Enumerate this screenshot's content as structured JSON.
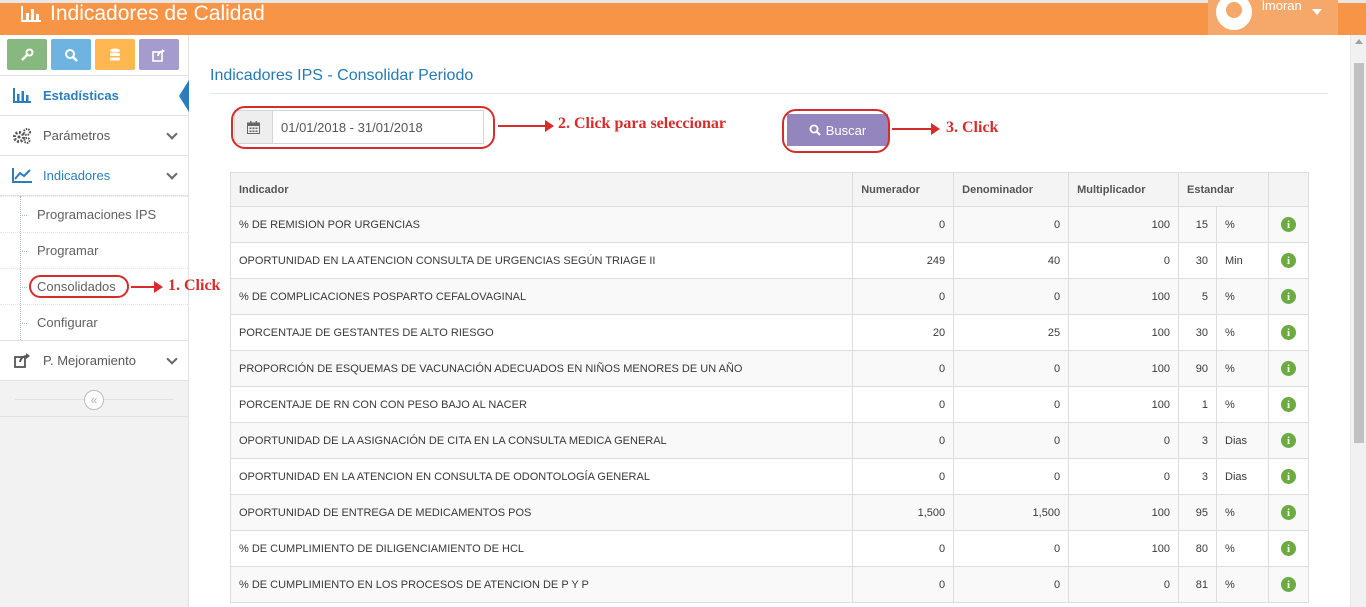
{
  "app": {
    "title": "Indicadores de Calidad",
    "brand_icon": "bar-chart-icon"
  },
  "user": {
    "name": "lmoran"
  },
  "sidebar": {
    "shortcuts": [
      {
        "icon": "wrench-icon",
        "color": "#87b87f"
      },
      {
        "icon": "search-icon",
        "color": "#6fb3e0"
      },
      {
        "icon": "database-icon",
        "color": "#ffb752"
      },
      {
        "icon": "share-icon",
        "color": "#a69bce"
      }
    ],
    "items": [
      {
        "label": "Estadísticas",
        "icon": "bar-chart-icon"
      },
      {
        "label": "Parámetros",
        "icon": "cogs-icon"
      },
      {
        "label": "Indicadores",
        "icon": "line-chart-icon"
      },
      {
        "label": "P. Mejoramiento",
        "icon": "share-icon"
      }
    ],
    "submenu": [
      "Programaciones IPS",
      "Programar",
      "Consolidados",
      "Configurar"
    ]
  },
  "main": {
    "title": "Indicadores IPS - Consolidar Periodo",
    "date_range": "01/01/2018 - 31/01/2018",
    "search_label": "Buscar"
  },
  "annotations": {
    "step1": "1. Click",
    "step2": "2. Click para seleccionar",
    "step3": "3. Click",
    "color": "#d62c2c"
  },
  "table": {
    "headers": [
      "Indicador",
      "Numerador",
      "Denominador",
      "Multiplicador",
      "Estandar"
    ],
    "rows": [
      {
        "indicador": "% DE REMISION POR URGENCIAS",
        "numerador": "0",
        "denominador": "0",
        "multiplicador": "100",
        "estandar": "15",
        "unidad": "%"
      },
      {
        "indicador": "OPORTUNIDAD EN LA ATENCION CONSULTA DE URGENCIAS SEGÚN TRIAGE II",
        "numerador": "249",
        "denominador": "40",
        "multiplicador": "0",
        "estandar": "30",
        "unidad": "Min"
      },
      {
        "indicador": "% DE COMPLICACIONES POSPARTO CEFALOVAGINAL",
        "numerador": "0",
        "denominador": "0",
        "multiplicador": "100",
        "estandar": "5",
        "unidad": "%"
      },
      {
        "indicador": "PORCENTAJE DE GESTANTES DE ALTO RIESGO",
        "numerador": "20",
        "denominador": "25",
        "multiplicador": "100",
        "estandar": "30",
        "unidad": "%"
      },
      {
        "indicador": "PROPORCIÓN DE ESQUEMAS DE VACUNACIÓN ADECUADOS EN NIÑOS MENORES DE UN AÑO",
        "numerador": "0",
        "denominador": "0",
        "multiplicador": "100",
        "estandar": "90",
        "unidad": "%"
      },
      {
        "indicador": "PORCENTAJE DE RN CON CON PESO BAJO AL NACER",
        "numerador": "0",
        "denominador": "0",
        "multiplicador": "100",
        "estandar": "1",
        "unidad": "%"
      },
      {
        "indicador": "OPORTUNIDAD DE LA ASIGNACIÓN DE CITA EN LA CONSULTA MEDICA GENERAL",
        "numerador": "0",
        "denominador": "0",
        "multiplicador": "0",
        "estandar": "3",
        "unidad": "Dias"
      },
      {
        "indicador": "OPORTUNIDAD EN LA ATENCION EN CONSULTA DE ODONTOLOGÍA GENERAL",
        "numerador": "0",
        "denominador": "0",
        "multiplicador": "0",
        "estandar": "3",
        "unidad": "Dias"
      },
      {
        "indicador": "OPORTUNIDAD DE ENTREGA DE MEDICAMENTOS POS",
        "numerador": "1,500",
        "denominador": "1,500",
        "multiplicador": "100",
        "estandar": "95",
        "unidad": "%"
      },
      {
        "indicador": "% DE CUMPLIMIENTO DE DILIGENCIAMIENTO DE HCL",
        "numerador": "0",
        "denominador": "0",
        "multiplicador": "100",
        "estandar": "80",
        "unidad": "%"
      },
      {
        "indicador": "% DE CUMPLIMIENTO EN LOS PROCESOS DE ATENCION DE P Y P",
        "numerador": "0",
        "denominador": "0",
        "multiplicador": "0",
        "estandar": "81",
        "unidad": "%"
      }
    ]
  }
}
